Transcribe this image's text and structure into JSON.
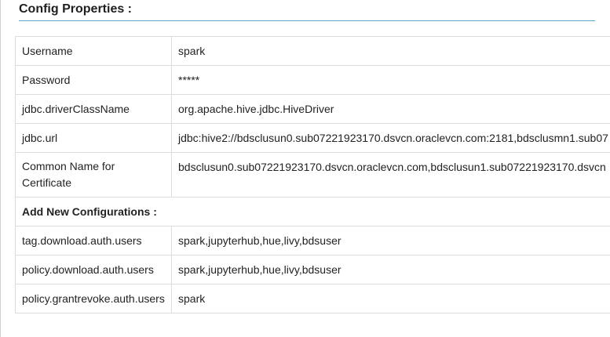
{
  "section": {
    "title": "Config Properties :"
  },
  "config_rows": [
    {
      "key": "Username",
      "value": "spark"
    },
    {
      "key": "Password",
      "value": "*****"
    },
    {
      "key": "jdbc.driverClassName",
      "value": "org.apache.hive.jdbc.HiveDriver"
    },
    {
      "key": "jdbc.url",
      "value": "jdbc:hive2://bdsclusun0.sub07221923170.dsvcn.oraclevcn.com:2181,bdsclusmn1.sub07"
    },
    {
      "key": "Common Name for Certificate",
      "value": "bdsclusun0.sub07221923170.dsvcn.oraclevcn.com,bdsclusun1.sub07221923170.dsvcn"
    }
  ],
  "new_configs": {
    "title": "Add New Configurations :",
    "rows": [
      {
        "key": "tag.download.auth.users",
        "value": "spark,jupyterhub,hue,livy,bdsuser"
      },
      {
        "key": "policy.download.auth.users",
        "value": "spark,jupyterhub,hue,livy,bdsuser"
      },
      {
        "key": "policy.grantrevoke.auth.users",
        "value": "spark"
      }
    ]
  }
}
